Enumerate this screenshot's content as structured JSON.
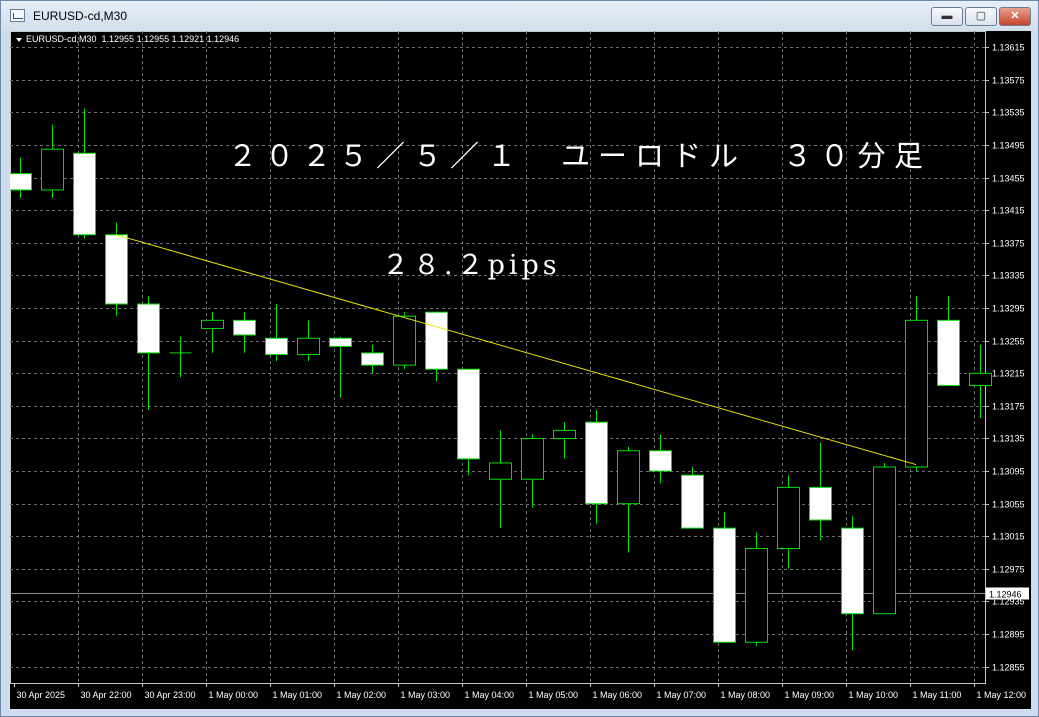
{
  "window": {
    "title": "EURUSD-cd,M30",
    "buttons": {
      "minimize": "▬",
      "maximize": "▢",
      "close": "✕"
    }
  },
  "chart_header": {
    "symbol_timeframe": "EURUSD-cd,M30",
    "ohlc": "1.12955 1.12955 1.12921 1.12946"
  },
  "annotations": {
    "title": "２０２５／５／１　ユーロドル　３０分足",
    "pips": "２８.２pips"
  },
  "colors": {
    "background": "#000000",
    "grid": "#6e6e6e",
    "bull_body": "#000000",
    "bear_body": "#ffffff",
    "candle_outline": "#00dd00",
    "trendline": "#e6e600",
    "current_price_line": "#8c8c8c"
  },
  "chart_data": {
    "type": "candlestick",
    "y_range": [
      1.12835,
      1.13635
    ],
    "y_ticks": [
      "1.13615",
      "1.13575",
      "1.13535",
      "1.13495",
      "1.13455",
      "1.13415",
      "1.13375",
      "1.13335",
      "1.13295",
      "1.13255",
      "1.13215",
      "1.13175",
      "1.13135",
      "1.13095",
      "1.13055",
      "1.13015",
      "1.12975",
      "1.12935",
      "1.12895",
      "1.12855"
    ],
    "x_labels": [
      "30 Apr 2025",
      "30 Apr 22:00",
      "30 Apr 23:00",
      "1 May 00:00",
      "1 May 01:00",
      "1 May 02:00",
      "1 May 03:00",
      "1 May 04:00",
      "1 May 05:00",
      "1 May 06:00",
      "1 May 07:00",
      "1 May 08:00",
      "1 May 09:00",
      "1 May 10:00",
      "1 May 11:00",
      "1 May 12:00"
    ],
    "current_price": "1.12946",
    "candles": [
      {
        "o": 1.1346,
        "h": 1.1348,
        "l": 1.1343,
        "c": 1.1344
      },
      {
        "o": 1.1344,
        "h": 1.1352,
        "l": 1.1343,
        "c": 1.1349
      },
      {
        "o": 1.13485,
        "h": 1.1354,
        "l": 1.1338,
        "c": 1.13385
      },
      {
        "o": 1.13385,
        "h": 1.134,
        "l": 1.13285,
        "c": 1.133
      },
      {
        "o": 1.133,
        "h": 1.1331,
        "l": 1.1317,
        "c": 1.1324
      },
      {
        "o": 1.1324,
        "h": 1.1326,
        "l": 1.1321,
        "c": 1.1324
      },
      {
        "o": 1.1327,
        "h": 1.1329,
        "l": 1.1324,
        "c": 1.1328
      },
      {
        "o": 1.1328,
        "h": 1.1329,
        "l": 1.1324,
        "c": 1.13262
      },
      {
        "o": 1.13258,
        "h": 1.133,
        "l": 1.1323,
        "c": 1.13238
      },
      {
        "o": 1.13238,
        "h": 1.1328,
        "l": 1.1323,
        "c": 1.13258
      },
      {
        "o": 1.13258,
        "h": 1.1326,
        "l": 1.13185,
        "c": 1.13248
      },
      {
        "o": 1.1324,
        "h": 1.1325,
        "l": 1.13215,
        "c": 1.13225
      },
      {
        "o": 1.13225,
        "h": 1.1329,
        "l": 1.1322,
        "c": 1.13285
      },
      {
        "o": 1.1329,
        "h": 1.1329,
        "l": 1.13205,
        "c": 1.1322
      },
      {
        "o": 1.1322,
        "h": 1.1322,
        "l": 1.1309,
        "c": 1.1311
      },
      {
        "o": 1.13085,
        "h": 1.13145,
        "l": 1.13025,
        "c": 1.13105
      },
      {
        "o": 1.13085,
        "h": 1.1314,
        "l": 1.1305,
        "c": 1.13135
      },
      {
        "o": 1.13135,
        "h": 1.13155,
        "l": 1.1311,
        "c": 1.13145
      },
      {
        "o": 1.13155,
        "h": 1.1317,
        "l": 1.1303,
        "c": 1.13055
      },
      {
        "o": 1.13055,
        "h": 1.13125,
        "l": 1.12995,
        "c": 1.1312
      },
      {
        "o": 1.1312,
        "h": 1.1314,
        "l": 1.1308,
        "c": 1.13095
      },
      {
        "o": 1.1309,
        "h": 1.131,
        "l": 1.13025,
        "c": 1.13025
      },
      {
        "o": 1.13025,
        "h": 1.13045,
        "l": 1.12885,
        "c": 1.12885
      },
      {
        "o": 1.12885,
        "h": 1.1302,
        "l": 1.1288,
        "c": 1.13
      },
      {
        "o": 1.13,
        "h": 1.1309,
        "l": 1.12975,
        "c": 1.13075
      },
      {
        "o": 1.13075,
        "h": 1.1313,
        "l": 1.1301,
        "c": 1.13035
      },
      {
        "o": 1.13025,
        "h": 1.1304,
        "l": 1.12875,
        "c": 1.1292
      },
      {
        "o": 1.1292,
        "h": 1.13105,
        "l": 1.1292,
        "c": 1.131
      },
      {
        "o": 1.131,
        "h": 1.1331,
        "l": 1.13095,
        "c": 1.1328
      },
      {
        "o": 1.1328,
        "h": 1.1331,
        "l": 1.132,
        "c": 1.132
      },
      {
        "o": 1.132,
        "h": 1.1325,
        "l": 1.1316,
        "c": 1.13215
      }
    ],
    "trendline": {
      "from": {
        "x_index": 3,
        "y": 1.13385
      },
      "to": {
        "x_index": 28,
        "y": 1.13103
      }
    }
  }
}
